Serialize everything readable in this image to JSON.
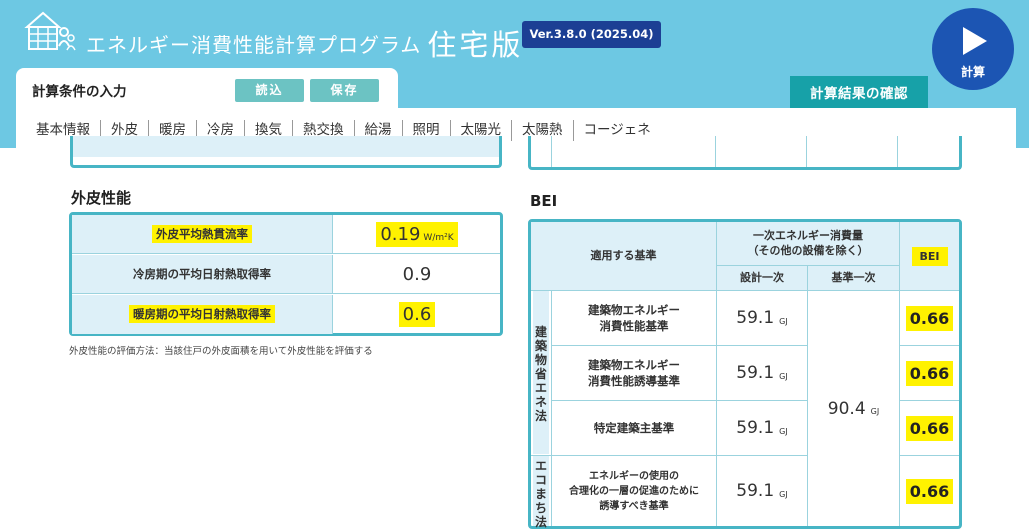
{
  "header": {
    "title": "エネルギー消費性能計算プログラム",
    "edition": "住宅版",
    "version": "Ver.3.8.0 (2025.04)",
    "calc_button_label": "計算",
    "logo_icon": "house-logo-icon",
    "colors": {
      "header_bg": "#6dc8e3",
      "version_badge": "#1c3f94",
      "calc_button": "#1c55b3",
      "accent_teal": "#17a1a8",
      "table_border": "#47b5c5",
      "highlight": "#fff200"
    }
  },
  "tabs": {
    "input_title": "計算条件の入力",
    "load_label": "読込",
    "save_label": "保存",
    "results_label": "計算結果の確認"
  },
  "subnav": [
    "基本情報",
    "外皮",
    "暖房",
    "冷房",
    "換気",
    "熱交換",
    "給湯",
    "照明",
    "太陽光",
    "太陽熱",
    "コージェネ"
  ],
  "envelope": {
    "heading": "外皮性能",
    "rows": [
      {
        "label": "外皮平均熱貫流率",
        "value": "0.19",
        "unit": "W/m²K"
      },
      {
        "label": "冷房期の平均日射熱取得率",
        "value": "0.9",
        "unit": ""
      },
      {
        "label": "暖房期の平均日射熱取得率",
        "value": "0.6",
        "unit": ""
      }
    ],
    "note": "外皮性能の評価方法：当該住戸の外皮面積を用いて外皮性能を評価する"
  },
  "bei": {
    "heading": "BEI",
    "col_standard": "適用する基準",
    "col_energy": "一次エネルギー消費量",
    "col_energy_sub": "（その他の設備を除く）",
    "col_design": "設計一次",
    "col_base": "基準一次",
    "col_bei": "BEI",
    "law_groups": [
      {
        "label": "建築物省エネ法"
      },
      {
        "label": "エコまち法"
      }
    ],
    "rows": [
      {
        "label_lines": [
          "建築物エネルギー",
          "消費性能基準"
        ],
        "design": "59.1",
        "bei": "0.66"
      },
      {
        "label_lines": [
          "建築物エネルギー",
          "消費性能誘導基準"
        ],
        "design": "59.1",
        "bei": "0.66"
      },
      {
        "label_lines": [
          "特定建築主基準"
        ],
        "design": "59.1",
        "bei": "0.66"
      },
      {
        "label_lines": [
          "エネルギーの使用の",
          "合理化の一層の促進のために",
          "誘導すべき基準"
        ],
        "design": "59.1",
        "bei": "0.66"
      }
    ],
    "base_value": "90.4",
    "unit": "GJ"
  }
}
